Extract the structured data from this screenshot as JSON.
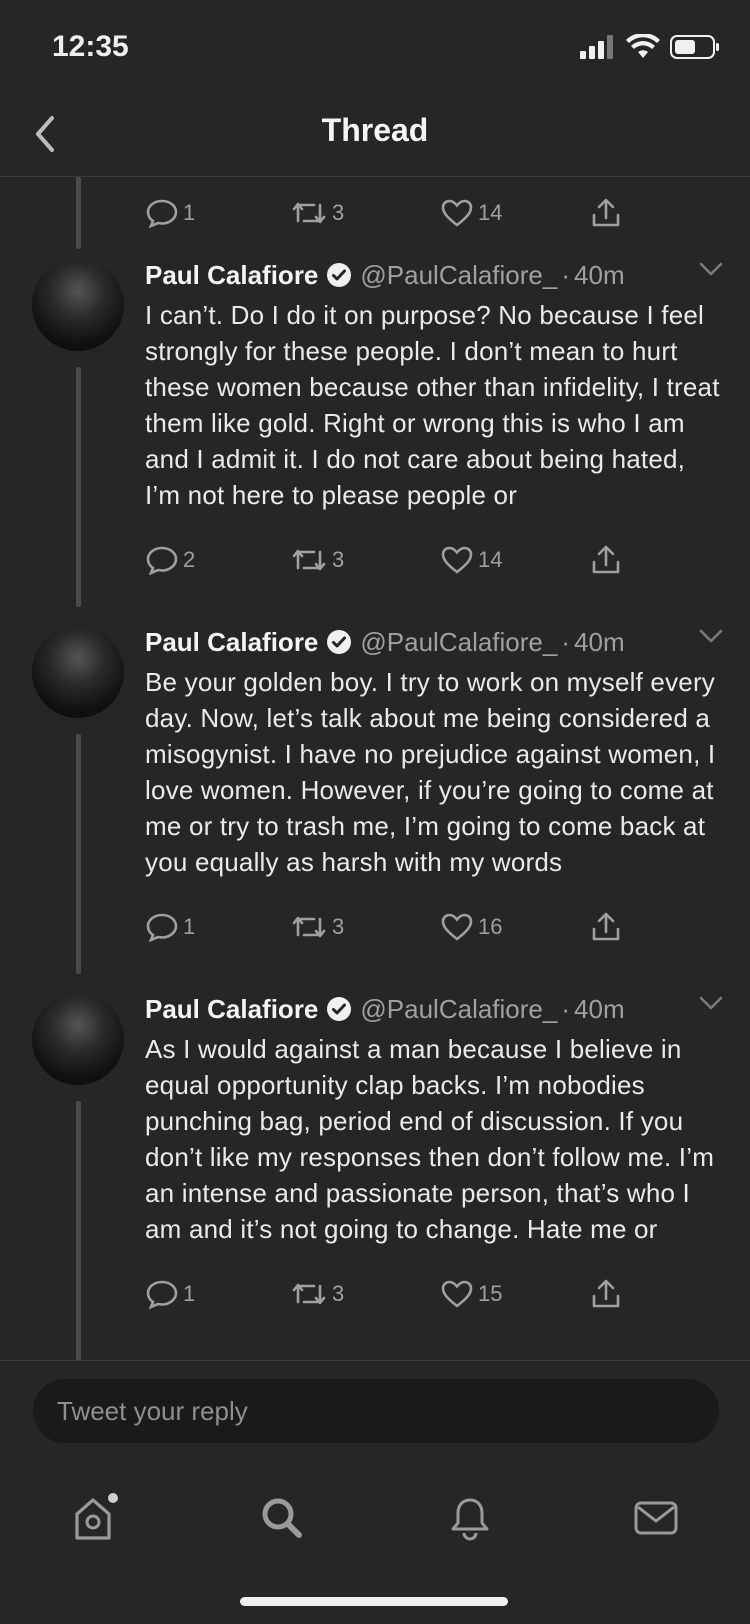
{
  "status_bar": {
    "time": "12:35"
  },
  "nav": {
    "title": "Thread"
  },
  "top_actions": {
    "replies": "1",
    "retweets": "3",
    "likes": "14"
  },
  "tweets": [
    {
      "author": "Paul Calafiore",
      "handle": "@PaulCalafiore_",
      "dot": "·",
      "time": "40m",
      "text": "I can’t. Do I do it on purpose? No because I feel strongly for these people. I don’t mean to hurt these women because other than infidelity, I treat them like gold. Right or wrong this is who I am and I admit it. I do not care about being hated, I’m not here to please people or",
      "replies": "2",
      "retweets": "3",
      "likes": "14"
    },
    {
      "author": "Paul Calafiore",
      "handle": "@PaulCalafiore_",
      "dot": "·",
      "time": "40m",
      "text": "Be your golden boy. I try to work on myself every day. Now, let’s talk about me being considered a misogynist. I have no prejudice against women, I love women. However, if you’re going to come at me or try to trash me, I’m going to come back at you equally as harsh with my words",
      "replies": "1",
      "retweets": "3",
      "likes": "16"
    },
    {
      "author": "Paul Calafiore",
      "handle": "@PaulCalafiore_",
      "dot": "·",
      "time": "40m",
      "text": "As I would against a man because I believe in equal opportunity clap backs. I’m nobodies punching bag, period end of discussion. If you don’t like my responses then don’t follow me. I’m an intense and passionate person, that’s who I am and it’s not going to change. Hate me or",
      "replies": "1",
      "retweets": "3",
      "likes": "15"
    }
  ],
  "reply": {
    "placeholder": "Tweet your reply"
  },
  "icons": {
    "back": "chevron-left-icon",
    "reply": "speech-bubble-icon",
    "retweet": "retweet-icon",
    "like": "heart-icon",
    "share": "share-icon",
    "verified": "verified-badge-icon",
    "home": "home-icon",
    "search": "search-icon",
    "notifications": "bell-icon",
    "messages": "mail-icon"
  },
  "colors": {
    "background": "#262626",
    "text": "#eaeaea",
    "muted": "#a0a0a0"
  }
}
